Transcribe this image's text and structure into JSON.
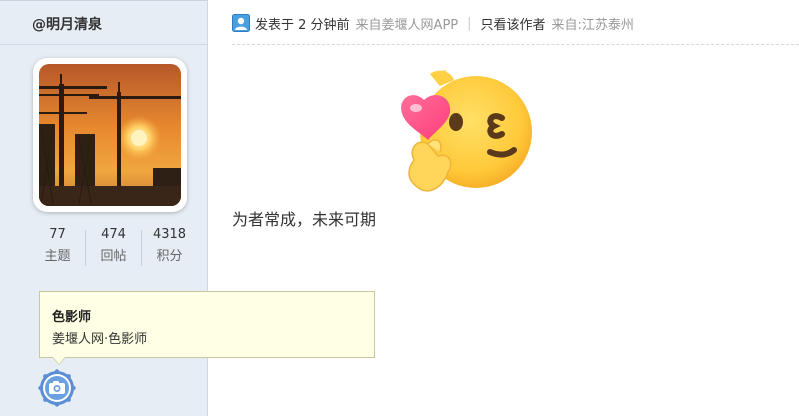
{
  "sidebar": {
    "username": "@明月清泉",
    "stats": [
      {
        "value": "77",
        "label": "主题"
      },
      {
        "value": "474",
        "label": "回帖"
      },
      {
        "value": "4318",
        "label": "积分"
      }
    ]
  },
  "tooltip": {
    "title": "色影师",
    "desc": "姜堰人网·色影师"
  },
  "post": {
    "posted": "发表于 2 分钟前",
    "source": "来自姜堰人网APP",
    "separator": "|",
    "only_author": "只看该作者",
    "location": "来自:江苏泰州",
    "content": "为者常成，未来可期"
  }
}
